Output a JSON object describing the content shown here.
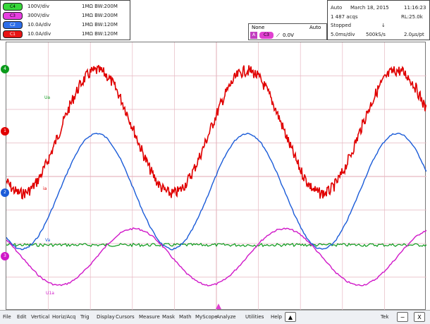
{
  "colors": {
    "ch1": "#0a9a1a",
    "ch2": "#e00000",
    "ch3": "#1a5bd8",
    "ch4": "#d017c8",
    "grid": "#e6b9c2",
    "trigger": "#e040d0"
  },
  "channels": [
    {
      "badge": "C4",
      "vdiv": "100V/div",
      "imp": "1MΩ BW:200M",
      "color_key": "ch1"
    },
    {
      "badge": "C3",
      "vdiv": "300V/div",
      "imp": "1MΩ BW:200M",
      "color_key": "ch4"
    },
    {
      "badge": "C2",
      "vdiv": "10.0A/div",
      "imp": "1MΩ BW:120M",
      "color_key": "ch3"
    },
    {
      "badge": "C1",
      "vdiv": "10.0A/div",
      "imp": "1MΩ BW:120M",
      "color_key": "ch2"
    }
  ],
  "trigger": {
    "mode": "None",
    "badge": "C3",
    "level": "0.0V",
    "coupling": "Auto",
    "source": "Auto"
  },
  "acquisition": {
    "mode": "Auto",
    "date": "March 18, 2015",
    "time": "11:16:23",
    "records": "1 487 acqs",
    "rl": "RL:25.0k",
    "state": "Stopped",
    "scale": "5.0ms/div",
    "rate": "500kS/s",
    "res": "2.0µs/pt"
  },
  "plot": {
    "labels": {
      "ua": "Ua",
      "ia": "ia",
      "va": "Va",
      "ui": "U1a"
    }
  },
  "menu": {
    "items": [
      "File",
      "Edit",
      "Vertical",
      "Horiz/Acq",
      "Trig",
      "Display",
      "Cursors",
      "Measure",
      "Mask",
      "Math",
      "MyScope",
      "Analyze",
      "Utilities",
      "Help"
    ],
    "right_label": "Tek",
    "help_arrow": "▲",
    "minimize": "−",
    "close": "X"
  }
}
